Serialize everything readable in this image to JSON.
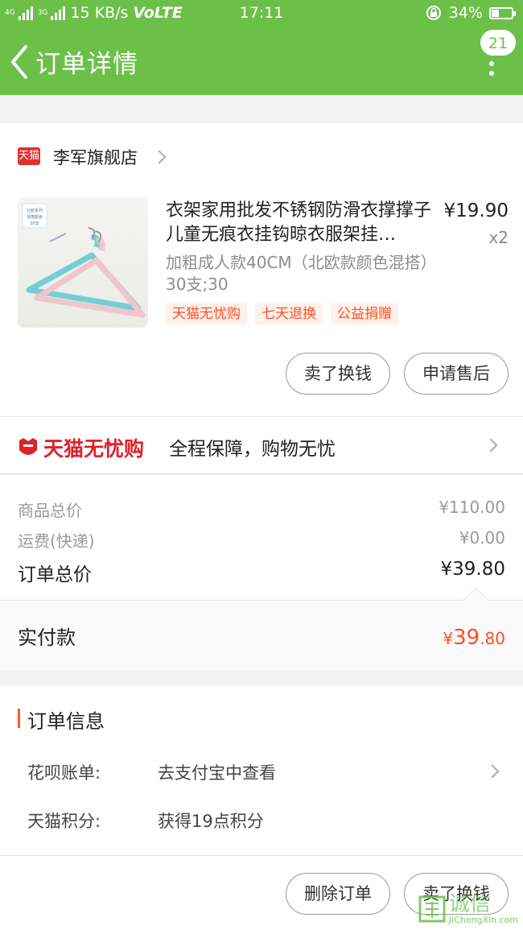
{
  "status_bar": {
    "carrier1": "4G",
    "carrier2": "3G",
    "speed": "15 KB/s",
    "volte": "VoLTE",
    "time": "17:11",
    "battery": "34%"
  },
  "header": {
    "title": "订单详情",
    "badge": "21"
  },
  "shop": {
    "name": "李军旗舰店",
    "logo_text": "天猫"
  },
  "product": {
    "thumb_text": "北欧系列\n混搭颜色\n30支",
    "name": "衣架家用批发不锈钢防滑衣撑撑子儿童无痕衣挂钩晾衣服架挂…",
    "price": "¥19.90",
    "qty": "x2",
    "spec": "加粗成人款40CM（北欧款颜色混搭）30支;30",
    "tags": [
      "天猫无忧购",
      "七天退换",
      "公益捐赠"
    ]
  },
  "item_actions": {
    "sell": "卖了换钱",
    "after_sale": "申请售后"
  },
  "assurance": {
    "logo": "天猫无忧购",
    "text": "全程保障，购物无忧"
  },
  "summary": {
    "goods_label": "商品总价",
    "goods_value": "¥110.00",
    "shipping_label": "运费(快递)",
    "shipping_value": "¥0.00",
    "total_label": "订单总价",
    "total_value": "¥39.80",
    "paid_label": "实付款",
    "paid_symbol": "¥",
    "paid_int": "39",
    "paid_dec": ".80"
  },
  "order_info": {
    "title": "订单信息",
    "huabei_label": "花呗账单:",
    "huabei_value": "去支付宝中查看",
    "points_label": "天猫积分:",
    "points_value": "获得19点积分"
  },
  "footer": {
    "delete": "删除订单",
    "sell": "卖了换钱"
  },
  "watermark": {
    "cn": "诚信",
    "en": "JiChengXin.com"
  },
  "colors": {
    "brand_green": "#6cc04a",
    "accent_orange": "#ff5a1f",
    "tmall_red": "#e03030"
  }
}
